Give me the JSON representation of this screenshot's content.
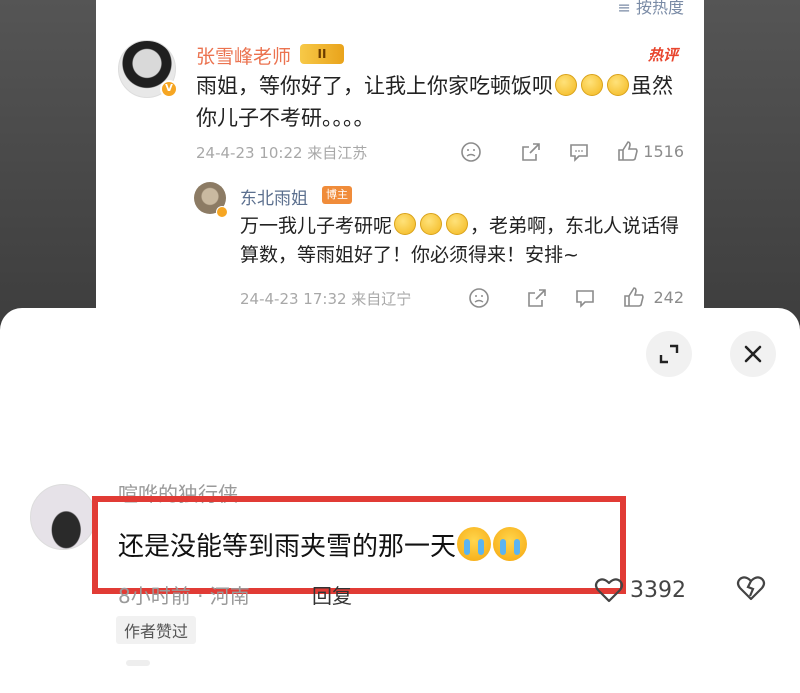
{
  "background_post": {
    "sort_label": "≡ 按热度",
    "comment1": {
      "author": "张雪峰老师",
      "level_badge": "II",
      "hot_tag": "热评",
      "text_before": "雨姐，等你好了，让我上你家吃顿饭呗",
      "text_after": "虽然你儿子不考研。。。。",
      "emoji_count": 3,
      "time": "24-4-23 10:22 来自江苏",
      "like_count": "1516"
    },
    "comment2": {
      "author": "东北雨姐",
      "author_tag": "博主",
      "text_before": "万一我儿子考研呢",
      "text_after": "，老弟啊，东北人说话得算数，等雨姐好了！你必须得来！安排~",
      "time": "24-4-23 17:32 来自辽宁",
      "like_count": "242"
    }
  },
  "sheet": {
    "comment": {
      "author": "喧哗的独行侠",
      "text": "还是没能等到雨夹雪的那一天",
      "time_location": "8小时前 · 河南",
      "reply_label": "回复",
      "like_count": "3392",
      "author_liked": "作者赞过"
    },
    "highlight_color": "#e13b35"
  },
  "colors": {
    "author_name": "#eb7350",
    "reply_name": "#5b6f8e",
    "meta_gray": "#a8a8a8"
  }
}
